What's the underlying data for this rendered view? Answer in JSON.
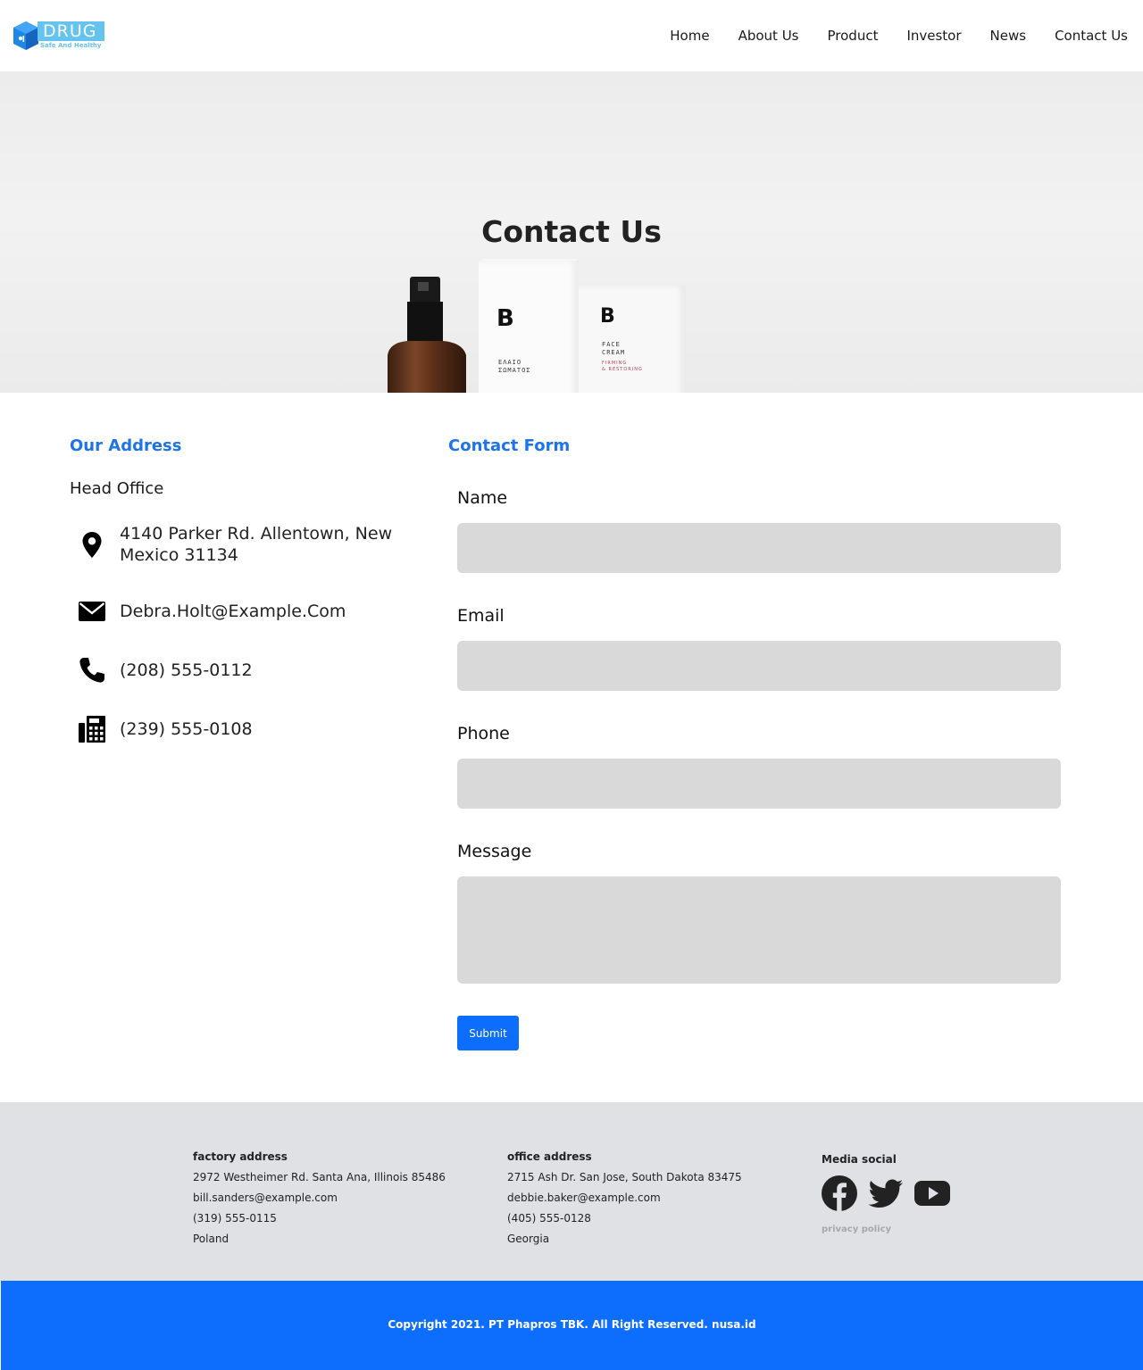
{
  "brand": {
    "logo_word": "DRUG",
    "logo_tagline": "Safe And Healthy",
    "logo_color": "#64c3ef",
    "cube_color": "#1e88e5"
  },
  "nav": {
    "items": [
      {
        "label": "Home"
      },
      {
        "label": "About Us"
      },
      {
        "label": "Product"
      },
      {
        "label": "Investor"
      },
      {
        "label": "News"
      },
      {
        "label": "Contact Us"
      }
    ]
  },
  "hero": {
    "title": "Contact Us",
    "box1_brand": "B",
    "box1_text": "ΕΛΑΙΟ\nΣΩΜΑΤΟΣ",
    "box2_brand": "B",
    "box2_text": "FACE\nCREAM",
    "box2_red": "FIRMING\n& RESTORING"
  },
  "address": {
    "title": "Our Address",
    "subtitle": "Head Office",
    "location": "4140 Parker Rd. Allentown, New Mexico 31134",
    "email": "Debra.Holt@Example.Com",
    "phone": "(208) 555-0112",
    "fax": "(239) 555-0108"
  },
  "form": {
    "title": "Contact Form",
    "name_label": "Name",
    "email_label": "Email",
    "phone_label": "Phone",
    "message_label": "Message",
    "submit_label": "Submit"
  },
  "footer": {
    "factory": {
      "heading": "factory address",
      "street": "2972 Westheimer Rd. Santa Ana, Illinois 85486",
      "email": "bill.sanders@example.com",
      "phone": "(319) 555-0115",
      "country": "Poland"
    },
    "office": {
      "heading": "office address",
      "street": "2715 Ash Dr. San Jose, South Dakota 83475",
      "email": "debbie.baker@example.com",
      "phone": "(405) 555-0128",
      "country": "Georgia"
    },
    "media": {
      "heading": "Media social",
      "icons": [
        "facebook-icon",
        "twitter-icon",
        "youtube-icon"
      ],
      "privacy": "privacy policy"
    },
    "copyright": "Copyright 2021. PT Phapros TBK. All Right Reserved. nusa.id"
  },
  "colors": {
    "accent": "#1e73e8",
    "button": "#0d6efd",
    "input_bg": "#d9d9d9",
    "footer_bg": "#dfe1e5"
  }
}
